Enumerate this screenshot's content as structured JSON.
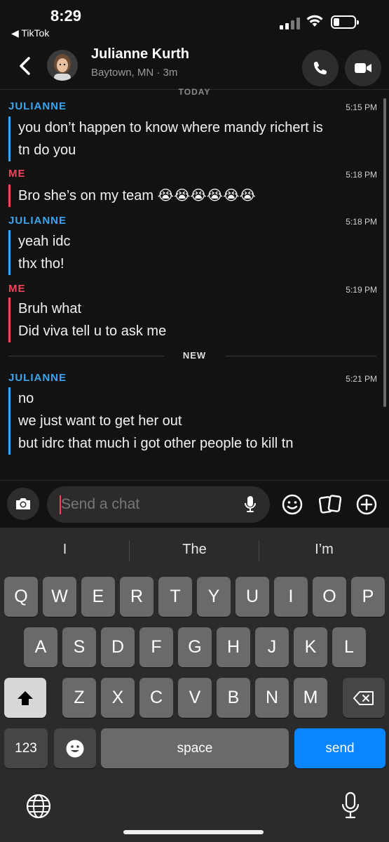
{
  "status_bar": {
    "time": "8:29",
    "back_app": "◀ TikTok"
  },
  "header": {
    "contact_name": "Julianne Kurth",
    "contact_sub": "Baytown, MN · 3m"
  },
  "day_separator": "TODAY",
  "new_separator": "NEW",
  "messages": [
    {
      "sender": "JULIANNE",
      "time": "5:15 PM",
      "lines": [
        "you don’t happen to know where mandy richert is",
        "tn do you"
      ]
    },
    {
      "sender": "ME",
      "time": "5:18 PM",
      "lines": [
        "Bro she’s on my team 😭😭😭😭😭😭"
      ]
    },
    {
      "sender": "JULIANNE",
      "time": "5:18 PM",
      "lines": [
        "yeah idc",
        "thx tho!"
      ]
    },
    {
      "sender": "ME",
      "time": "5:19 PM",
      "lines": [
        "Bruh what",
        "Did viva tell u to ask me"
      ]
    },
    {
      "sender": "JULIANNE",
      "time": "5:21 PM",
      "lines": [
        "no",
        "we just want to get her out",
        "but idrc that much i got other people to kill tn"
      ]
    }
  ],
  "input": {
    "placeholder": "Send a chat",
    "value": ""
  },
  "keyboard": {
    "suggestions": [
      "I",
      "The",
      "I’m"
    ],
    "row1": [
      "Q",
      "W",
      "E",
      "R",
      "T",
      "Y",
      "U",
      "I",
      "O",
      "P"
    ],
    "row2": [
      "A",
      "S",
      "D",
      "F",
      "G",
      "H",
      "J",
      "K",
      "L"
    ],
    "row3": [
      "Z",
      "X",
      "C",
      "V",
      "B",
      "N",
      "M"
    ],
    "num_label": "123",
    "space_label": "space",
    "send_label": "send"
  },
  "colors": {
    "friend": "#3aa6f0",
    "me": "#f0455a",
    "send_key": "#0a84ff"
  },
  "icons": {
    "header": [
      "chevron-left-icon",
      "phone-icon",
      "video-camera-icon"
    ],
    "input": [
      "camera-icon",
      "microphone-icon",
      "smiley-icon",
      "cards-icon",
      "plus-icon"
    ],
    "keyboard": [
      "shift-icon",
      "backspace-icon",
      "emoji-icon",
      "globe-icon",
      "dictation-mic-icon"
    ]
  }
}
